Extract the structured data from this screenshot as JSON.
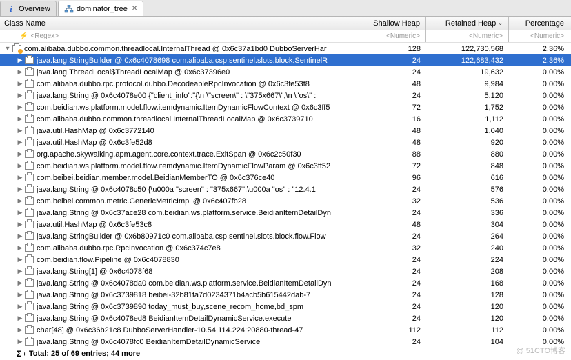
{
  "tabs": {
    "overview": "Overview",
    "dominator": "dominator_tree"
  },
  "columns": {
    "name": "Class Name",
    "shallow": "Shallow Heap",
    "retained": "Retained Heap",
    "percentage": "Percentage"
  },
  "filter": {
    "regex": "<Regex>",
    "numeric": "<Numeric>"
  },
  "rows": [
    {
      "indent": 0,
      "expand": "down",
      "icon": "thread",
      "label": "com.alibaba.dubbo.common.threadlocal.InternalThread @ 0x6c37a1bd0  DubboServerHar",
      "shallow": "128",
      "retained": "122,730,568",
      "pct": "2.36%",
      "selected": false
    },
    {
      "indent": 1,
      "expand": "right",
      "icon": "class",
      "label": "java.lang.StringBuilder @ 0x6c4078698  com.alibaba.csp.sentinel.slots.block.SentinelR",
      "shallow": "24",
      "retained": "122,683,432",
      "pct": "2.36%",
      "selected": true
    },
    {
      "indent": 1,
      "expand": "right",
      "icon": "class",
      "label": "java.lang.ThreadLocal$ThreadLocalMap @ 0x6c37396e0",
      "shallow": "24",
      "retained": "19,632",
      "pct": "0.00%",
      "selected": false
    },
    {
      "indent": 1,
      "expand": "right",
      "icon": "class",
      "label": "com.alibaba.dubbo.rpc.protocol.dubbo.DecodeableRpcInvocation @ 0x6c3fe53f8",
      "shallow": "48",
      "retained": "9,984",
      "pct": "0.00%",
      "selected": false
    },
    {
      "indent": 1,
      "expand": "right",
      "icon": "class",
      "label": "java.lang.String @ 0x6c4078e00  {\"client_info\":\"{\\n  \\\"screen\\\" : \\\"375x667\\\",\\n  \\\"os\\\" :",
      "shallow": "24",
      "retained": "5,120",
      "pct": "0.00%",
      "selected": false
    },
    {
      "indent": 1,
      "expand": "right",
      "icon": "class",
      "label": "com.beidian.ws.platform.model.flow.itemdynamic.ItemDynamicFlowContext @ 0x6c3ff5",
      "shallow": "72",
      "retained": "1,752",
      "pct": "0.00%",
      "selected": false
    },
    {
      "indent": 1,
      "expand": "right",
      "icon": "class",
      "label": "com.alibaba.dubbo.common.threadlocal.InternalThreadLocalMap @ 0x6c3739710",
      "shallow": "16",
      "retained": "1,112",
      "pct": "0.00%",
      "selected": false
    },
    {
      "indent": 1,
      "expand": "right",
      "icon": "class",
      "label": "java.util.HashMap @ 0x6c3772140",
      "shallow": "48",
      "retained": "1,040",
      "pct": "0.00%",
      "selected": false
    },
    {
      "indent": 1,
      "expand": "right",
      "icon": "class",
      "label": "java.util.HashMap @ 0x6c3fe52d8",
      "shallow": "48",
      "retained": "920",
      "pct": "0.00%",
      "selected": false
    },
    {
      "indent": 1,
      "expand": "right",
      "icon": "class",
      "label": "org.apache.skywalking.apm.agent.core.context.trace.ExitSpan @ 0x6c2c50f30",
      "shallow": "88",
      "retained": "880",
      "pct": "0.00%",
      "selected": false
    },
    {
      "indent": 1,
      "expand": "right",
      "icon": "class",
      "label": "com.beidian.ws.platform.model.flow.itemdynamic.ItemDynamicFlowParam @ 0x6c3ff52",
      "shallow": "72",
      "retained": "848",
      "pct": "0.00%",
      "selected": false
    },
    {
      "indent": 1,
      "expand": "right",
      "icon": "class",
      "label": "com.beibei.beidian.member.model.BeidianMemberTO @ 0x6c376ce40",
      "shallow": "96",
      "retained": "616",
      "pct": "0.00%",
      "selected": false
    },
    {
      "indent": 1,
      "expand": "right",
      "icon": "class",
      "label": "java.lang.String @ 0x6c4078c50  {\\u000a  \"screen\" : \"375x667\",\\u000a  \"os\" : \"12.4.1",
      "shallow": "24",
      "retained": "576",
      "pct": "0.00%",
      "selected": false
    },
    {
      "indent": 1,
      "expand": "right",
      "icon": "class",
      "label": "com.beibei.common.metric.GenericMetricImpl @ 0x6c407fb28",
      "shallow": "32",
      "retained": "536",
      "pct": "0.00%",
      "selected": false
    },
    {
      "indent": 1,
      "expand": "right",
      "icon": "class",
      "label": "java.lang.String @ 0x6c37ace28  com.beidian.ws.platform.service.BeidianItemDetailDyn",
      "shallow": "24",
      "retained": "336",
      "pct": "0.00%",
      "selected": false
    },
    {
      "indent": 1,
      "expand": "right",
      "icon": "class",
      "label": "java.util.HashMap @ 0x6c3fe53c8",
      "shallow": "48",
      "retained": "304",
      "pct": "0.00%",
      "selected": false
    },
    {
      "indent": 1,
      "expand": "right",
      "icon": "class",
      "label": "java.lang.StringBuilder @ 0x6b80971c0  com.alibaba.csp.sentinel.slots.block.flow.Flow",
      "shallow": "24",
      "retained": "264",
      "pct": "0.00%",
      "selected": false
    },
    {
      "indent": 1,
      "expand": "right",
      "icon": "class",
      "label": "com.alibaba.dubbo.rpc.RpcInvocation @ 0x6c374c7e8",
      "shallow": "32",
      "retained": "240",
      "pct": "0.00%",
      "selected": false
    },
    {
      "indent": 1,
      "expand": "right",
      "icon": "class",
      "label": "com.beidian.flow.Pipeline @ 0x6c4078830",
      "shallow": "24",
      "retained": "224",
      "pct": "0.00%",
      "selected": false
    },
    {
      "indent": 1,
      "expand": "right",
      "icon": "class",
      "label": "java.lang.String[1] @ 0x6c4078f68",
      "shallow": "24",
      "retained": "208",
      "pct": "0.00%",
      "selected": false
    },
    {
      "indent": 1,
      "expand": "right",
      "icon": "class",
      "label": "java.lang.String @ 0x6c4078da0  com.beidian.ws.platform.service.BeidianItemDetailDyn",
      "shallow": "24",
      "retained": "168",
      "pct": "0.00%",
      "selected": false
    },
    {
      "indent": 1,
      "expand": "right",
      "icon": "class",
      "label": "java.lang.String @ 0x6c3739818  beibei-32b81fa7d0234371b4acb5b615442dab-7",
      "shallow": "24",
      "retained": "128",
      "pct": "0.00%",
      "selected": false
    },
    {
      "indent": 1,
      "expand": "right",
      "icon": "class",
      "label": "java.lang.String @ 0x6c3739890  today_must_buy,scene_recom_home,bd_spm",
      "shallow": "24",
      "retained": "120",
      "pct": "0.00%",
      "selected": false
    },
    {
      "indent": 1,
      "expand": "right",
      "icon": "class",
      "label": "java.lang.String @ 0x6c4078ed8  BeidianItemDetailDynamicService.execute",
      "shallow": "24",
      "retained": "120",
      "pct": "0.00%",
      "selected": false
    },
    {
      "indent": 1,
      "expand": "right",
      "icon": "class",
      "label": "char[48] @ 0x6c36b21c8  DubboServerHandler-10.54.114.224:20880-thread-47",
      "shallow": "112",
      "retained": "112",
      "pct": "0.00%",
      "selected": false
    },
    {
      "indent": 1,
      "expand": "right",
      "icon": "class",
      "label": "java.lang.String @ 0x6c4078fc0  BeidianItemDetailDynamicService",
      "shallow": "24",
      "retained": "104",
      "pct": "0.00%",
      "selected": false
    }
  ],
  "total": "Total: 25 of 69 entries; 44 more",
  "watermark": "@ 51CTO博客"
}
